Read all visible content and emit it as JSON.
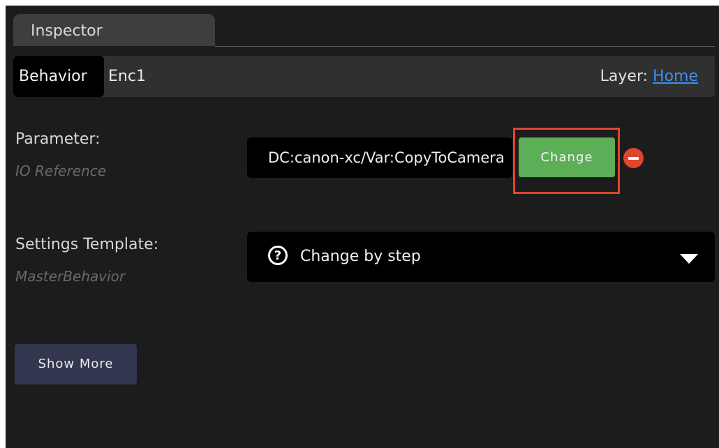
{
  "inspector": {
    "tab_label": "Inspector"
  },
  "header": {
    "behavior_tab": "Behavior",
    "control_name": "Enc1",
    "layer_prefix": "Layer: ",
    "layer_link": "Home"
  },
  "parameter": {
    "label": "Parameter:",
    "sublabel": "IO Reference",
    "value": "DC:canon-xc/Var:CopyToCamera",
    "change_button": "Change",
    "remove_icon": "minus-circle-icon",
    "highlight_color": "#e0452e"
  },
  "settings_template": {
    "label": "Settings Template:",
    "sublabel": "MasterBehavior",
    "selected": "Change by step",
    "help_icon": "?",
    "caret_icon": "chevron-down-icon"
  },
  "actions": {
    "show_more": "Show More"
  },
  "colors": {
    "background": "#1c1c1c",
    "change_button": "#5cae57",
    "show_more_button": "#33364f",
    "link": "#3e8ff0"
  }
}
